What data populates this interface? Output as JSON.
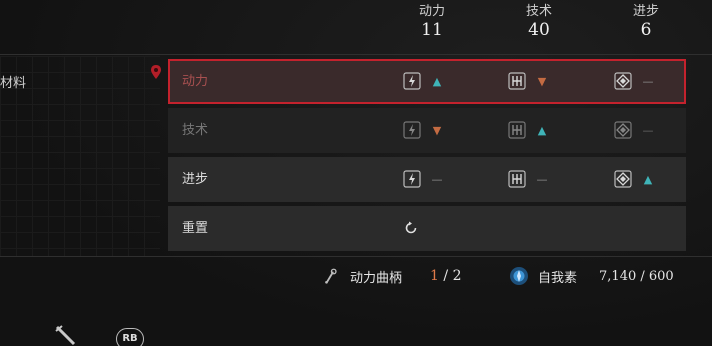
{
  "stats": [
    {
      "label": "动力",
      "value": "11"
    },
    {
      "label": "技术",
      "value": "40"
    },
    {
      "label": "进步",
      "value": "6"
    }
  ],
  "side_label": "材料",
  "rows": [
    {
      "name": "动力",
      "state": "selected",
      "indicators": [
        "up",
        "down",
        "flat"
      ]
    },
    {
      "name": "技术",
      "state": "disabled",
      "indicators": [
        "down",
        "up",
        "flat"
      ]
    },
    {
      "name": "进步",
      "state": "normal",
      "indicators": [
        "flat",
        "flat",
        "up"
      ]
    }
  ],
  "indicator_glyphs": {
    "up": "▲",
    "down": "▼",
    "flat": "—"
  },
  "reset": {
    "label": "重置",
    "icon": "reset-icon"
  },
  "footer": {
    "crank_label": "动力曲柄",
    "crank_current": "1",
    "crank_sep": " / ",
    "crank_max": "2",
    "ego_label": "自我素",
    "ego_value": "7,140 / 600"
  },
  "controls": {
    "rb_label": "RB"
  },
  "colors": {
    "accent_red": "#c4222d",
    "up_teal": "#3fb4b8",
    "down_orange": "#c46b42",
    "crank_current": "#e07a4a"
  },
  "icons": [
    "power-stat-icon",
    "technique-stat-icon",
    "advance-stat-icon",
    "crank-icon",
    "ego-icon",
    "weapon-icon",
    "map-pin-icon"
  ]
}
